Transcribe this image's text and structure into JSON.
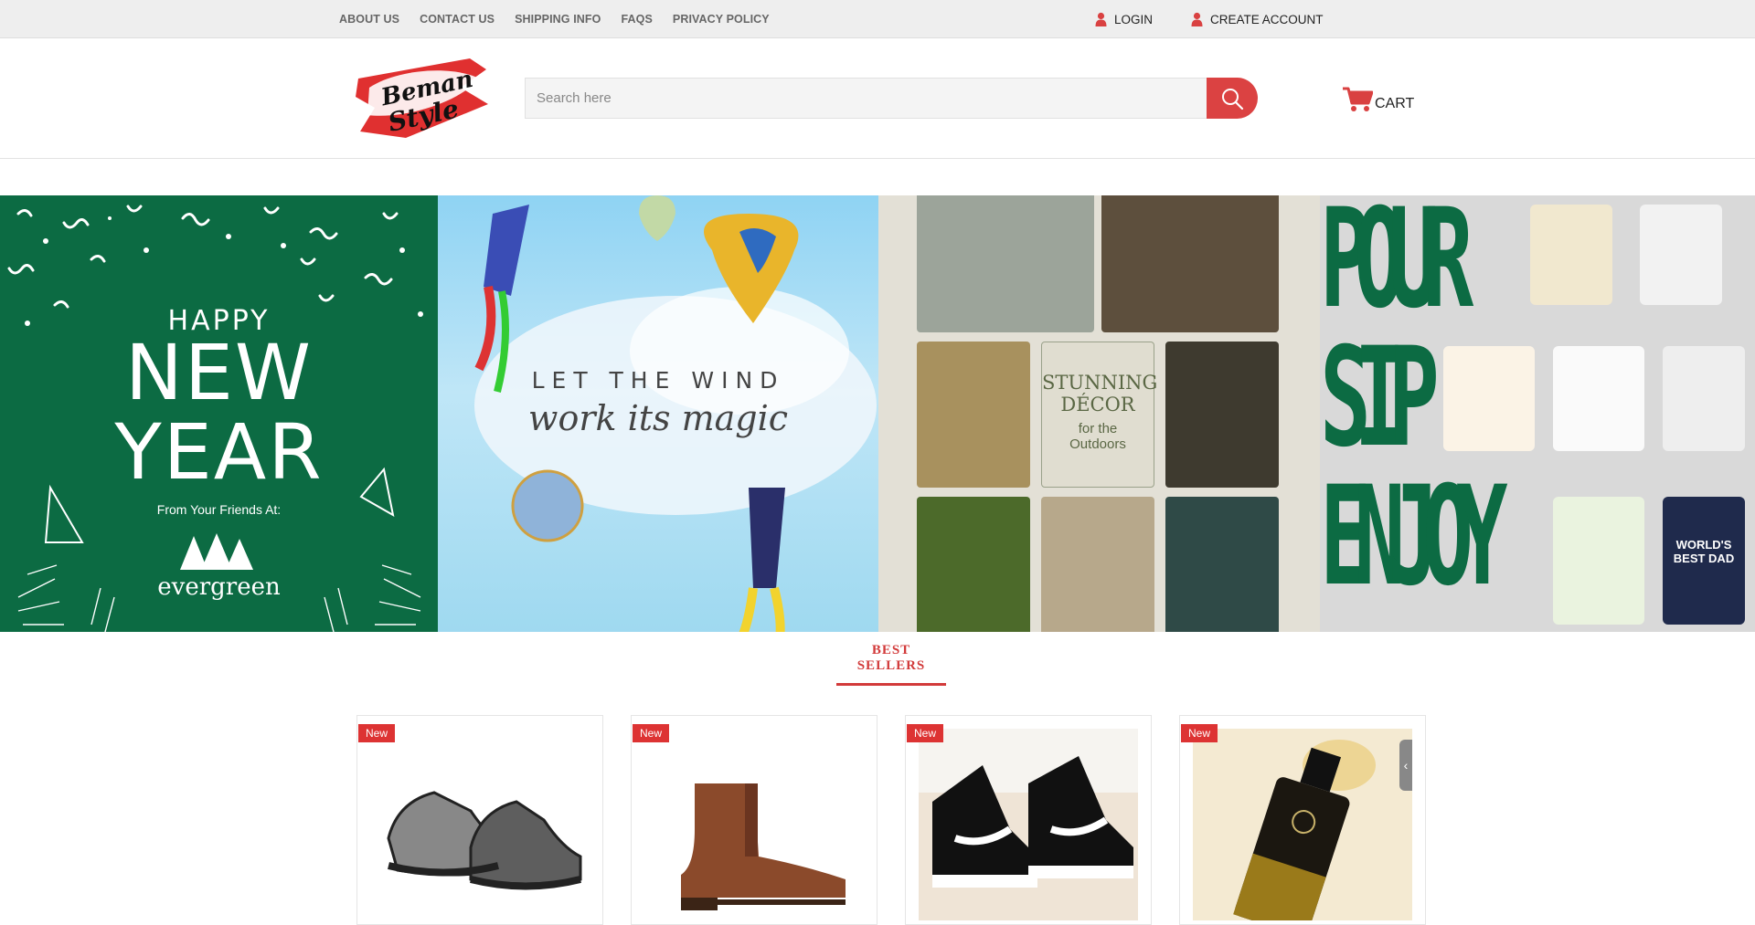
{
  "topbar": {
    "links": [
      "ABOUT US",
      "CONTACT US",
      "SHIPPING INFO",
      "FAQS",
      "PRIVACY POLICY"
    ],
    "login_label": "LOGIN",
    "create_account_label": "CREATE ACCOUNT"
  },
  "header": {
    "logo_text_line1": "Beman",
    "logo_text_line2": "Style",
    "search_placeholder": "Search here",
    "cart_label": "CART"
  },
  "banner": {
    "panel1": {
      "line1": "HAPPY",
      "line2": "NEW",
      "line3": "YEAR",
      "from": "From Your Friends At:",
      "brand": "evergreen"
    },
    "panel2": {
      "line1": "LET THE WIND",
      "line2": "work its magic"
    },
    "panel3": {
      "line1": "STUNNING",
      "line2": "DÉCOR",
      "line3": "for the",
      "line4": "Outdoors"
    },
    "panel4": {
      "line1": "POUR",
      "line2": "SIP",
      "line3": "ENJOY",
      "mug_text": "WORLD'S BEST DAD"
    }
  },
  "best_sellers": {
    "title": "BEST SELLERS",
    "products": [
      {
        "badge": "New",
        "item": "sneaker"
      },
      {
        "badge": "New",
        "item": "chelsea-boot"
      },
      {
        "badge": "New",
        "item": "high-top-sneaker"
      },
      {
        "badge": "New",
        "item": "oil-bottle"
      }
    ]
  },
  "colors": {
    "accent": "#db4242",
    "topbar_bg": "#eeeeee",
    "banner_green": "#0c6b43"
  }
}
